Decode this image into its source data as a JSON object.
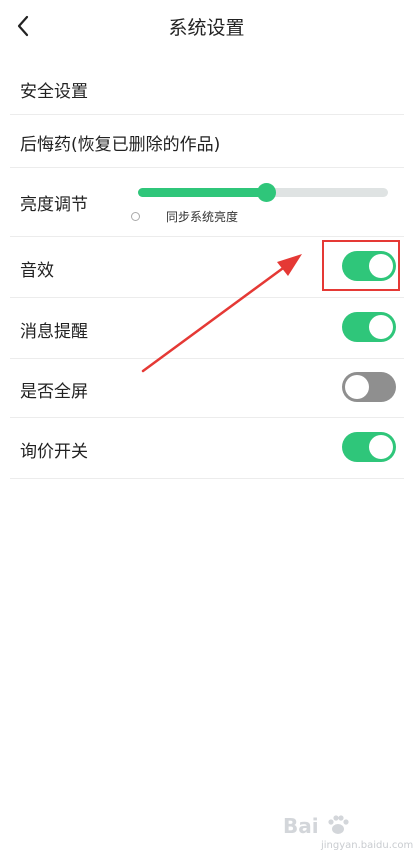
{
  "header": {
    "title": "系统设置"
  },
  "rows": {
    "security": {
      "label": "安全设置"
    },
    "regret": {
      "label": "后悔药(恢复已删除的作品)"
    },
    "brightness": {
      "label": "亮度调节",
      "value_percent": 51,
      "sync_label": "同步系统亮度",
      "sync_checked": false
    },
    "sound": {
      "label": "音效",
      "on": true
    },
    "message": {
      "label": "消息提醒",
      "on": true
    },
    "fullscreen": {
      "label": "是否全屏",
      "on": false
    },
    "inquiry": {
      "label": "询价开关",
      "on": true
    }
  },
  "colors": {
    "accent": "#2fc67a",
    "toggle_off": "#8f8f8f",
    "annotation": "#e53935"
  },
  "icons": {
    "back": "chevron-left-icon"
  },
  "watermark": {
    "brand": "Bai",
    "sub": "jingyan.baidu.com"
  }
}
